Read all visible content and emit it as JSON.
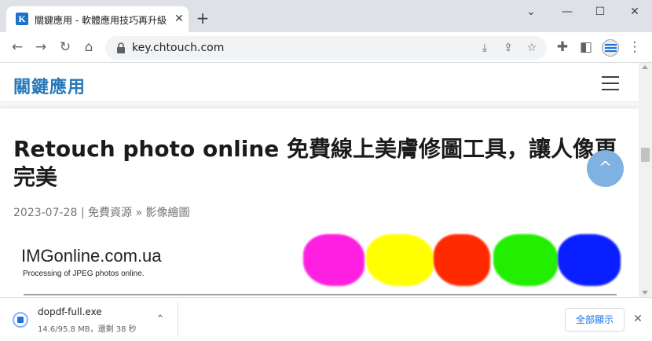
{
  "browser": {
    "tab": {
      "favicon_letter": "K",
      "title": "關鍵應用 - 軟體應用技巧再升級",
      "close_glyph": "✕"
    },
    "new_tab_glyph": "+",
    "window_controls": {
      "collapse": "⌄",
      "minimize": "—",
      "maximize": "☐",
      "close": "✕"
    },
    "toolbar": {
      "back": "←",
      "forward": "→",
      "reload": "↻",
      "home": "⌂",
      "url": "key.chtouch.com",
      "install_icon": "⤓",
      "share_icon": "⇪",
      "bookmark_icon": "☆",
      "extensions_icon": "✚",
      "side_panel_icon": "◧",
      "menu_icon": "⋮"
    }
  },
  "page": {
    "site_logo": "關鍵應用",
    "article": {
      "title": "Retouch photo online 免費線上美膚修圖工具，讓人像更完美",
      "date": "2023-07-28",
      "separator": " | ",
      "category": "免費資源",
      "crumb_sep": " » ",
      "subcategory": "影像繪圖"
    },
    "to_top_glyph": "^",
    "banner": {
      "title": "IMGonline.com.ua",
      "subtitle": "Processing of JPEG photos online.",
      "blob_colors": [
        "#ff1fe0",
        "#ffff00",
        "#ff2a00",
        "#22ee00",
        "#0a1fff"
      ]
    }
  },
  "download_shelf": {
    "filename": "dopdf-full.exe",
    "status": "14.6/95.8 MB，還剩 38 秒",
    "chevron": "⌃",
    "show_all_label": "全部顯示",
    "close_glyph": "✕"
  },
  "colors": {
    "brand": "#2878b8",
    "to_top_bg": "#7fb2e0",
    "link": "#1a73e8"
  }
}
